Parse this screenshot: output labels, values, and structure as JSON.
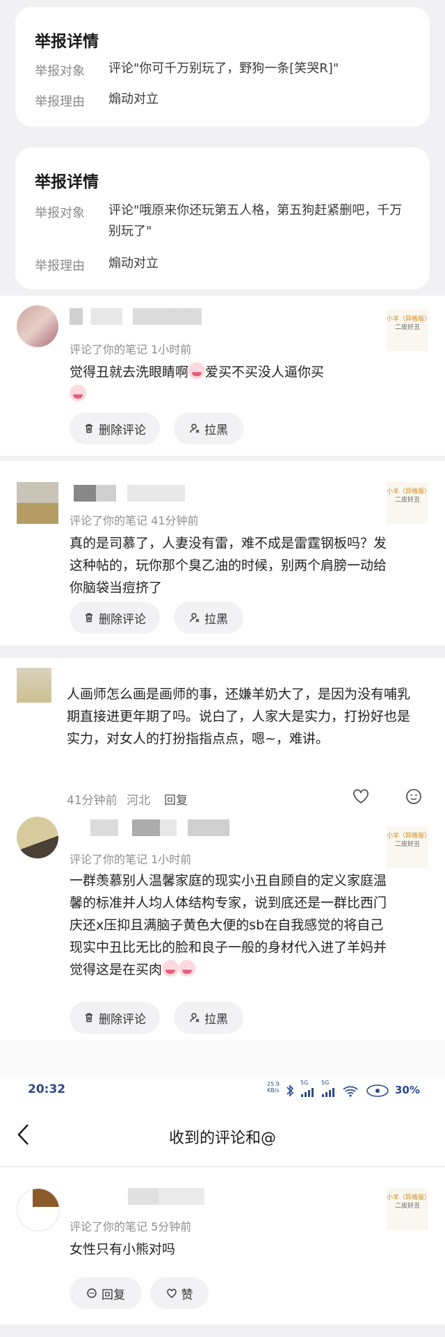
{
  "reports": [
    {
      "title": "举报详情",
      "target_label": "举报对象",
      "target_value": "评论\"你可千万别玩了，野狗一条[笑哭R]\"",
      "reason_label": "举报理由",
      "reason_value": "煽动对立"
    },
    {
      "title": "举报详情",
      "target_label": "举报对象",
      "target_value": "评论\"哦原来你还玩第五人格，第五狗赶紧删吧，千万别玩了\"",
      "reason_label": "举报理由",
      "reason_value": "煽动对立"
    }
  ],
  "thumb": {
    "line1": "小羊（异格版）",
    "line2": "二皮好丑"
  },
  "comments": [
    {
      "meta": "评论了你的笔记  1小时前",
      "text": "觉得丑就去洗眼睛啊",
      "text_after": "爱买不买没人逼你买",
      "btn_delete": "删除评论",
      "btn_block": "拉黑"
    },
    {
      "meta": "评论了你的笔记  41分钟前",
      "text": "真的是司慕了，人妻没有雷，难不成是雷霆钢板吗？发这种帖的，玩你那个臭乙油的时候，别两个肩膀一动给你脑袋当痘挤了",
      "btn_delete": "删除评论",
      "btn_block": "拉黑"
    },
    {
      "text": "人画师怎么画是画师的事，还嫌羊奶大了，是因为没有哺乳期直接进更年期了吗。说白了，人家大是实力，打扮好也是实力，对女人的打扮指指点点，嗯~，难讲。",
      "meta_time": "41分钟前",
      "meta_loc": "河北",
      "reply": "回复"
    },
    {
      "meta": "评论了你的笔记  1小时前",
      "text": "一群羡慕别人温馨家庭的现实小丑自顾自的定义家庭温馨的标准并人均人体结构专家，说到底还是一群比西门庆还x压抑且满脑子黄色大便的sb在自我感觉的将自己现实中丑比无比的脸和良子一般的身材代入进了羊妈并觉得这是在买肉",
      "btn_delete": "删除评论",
      "btn_block": "拉黑"
    }
  ],
  "status_bar": {
    "time": "20:32",
    "speed": "25.9",
    "speed_unit": "KB/s",
    "battery": "30%",
    "net1": "5G",
    "net2": "5G"
  },
  "nav": {
    "title": "收到的评论和@"
  },
  "last_comment": {
    "meta": "评论了你的笔记  5分钟前",
    "text": "女性只有小熊对吗",
    "btn_reply": "回复",
    "btn_like": "赞"
  }
}
